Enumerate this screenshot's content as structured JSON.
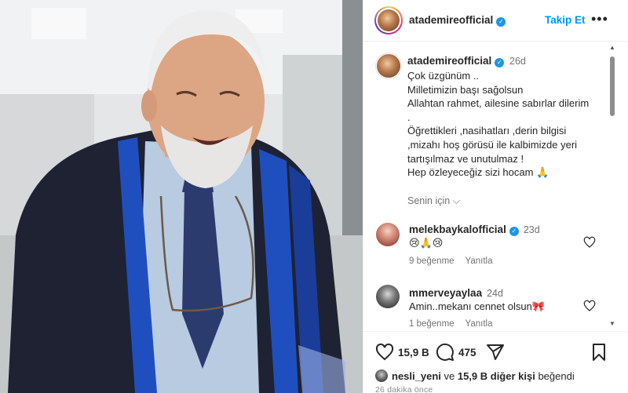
{
  "header": {
    "username": "atademireofficial",
    "follow_label": "Takip Et",
    "more_glyph": "•••"
  },
  "caption": {
    "username": "atademireofficial",
    "time": "26d",
    "text": "Çok üzgünüm ..\nMilletimizin başı sağolsun\nAllahtan rahmet, ailesine sabırlar dilerim\n.\nÖğrettikleri ,nasihatları ,derin bilgisi\n,mizahı hoş görüsü ile kalbimizde yeri\ntartışılmaz ve unutulmaz !\nHep özleyeceğiz sizi hocam 🙏",
    "translate_label": "Senin için ⌵"
  },
  "comments": [
    {
      "username": "melekbaykalofficial",
      "verified": true,
      "time": "23d",
      "text": "😢🙏😢",
      "likes_label": "9 beğenme",
      "reply_label": "Yanıtla"
    },
    {
      "username": "mmerveyaylaa",
      "verified": false,
      "time": "24d",
      "text": "Amin..mekanı cennet olsun🎀",
      "likes_label": "1 beğenme",
      "reply_label": "Yanıtla"
    }
  ],
  "actions": {
    "like_count": "15,9 B",
    "comment_count": "475"
  },
  "liked_by": {
    "user": "nesli_yeni",
    "connector": " ve ",
    "others": "15,9 B diğer kişi",
    "suffix": " beğendi"
  },
  "timestamp": "26 dakika önce",
  "colors": {
    "accent": "#0095f6",
    "verified": "#1c96e8",
    "text": "#262626",
    "muted": "#737373"
  },
  "icons": [
    "verified-badge-icon",
    "more-options-icon",
    "heart-icon",
    "comment-icon",
    "share-icon",
    "bookmark-icon",
    "chevron-down-icon"
  ]
}
